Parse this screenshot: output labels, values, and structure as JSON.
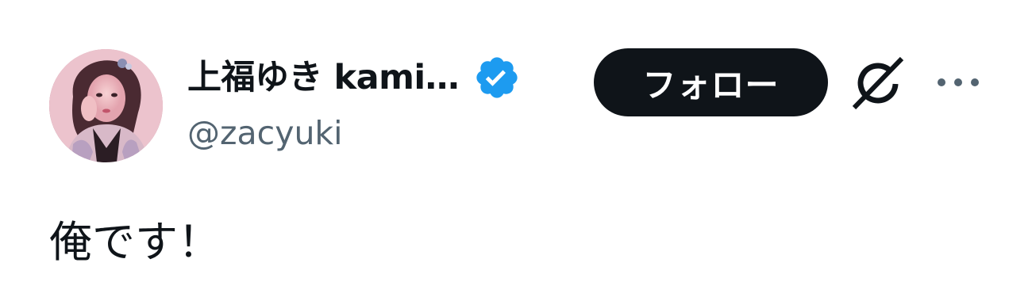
{
  "author": {
    "display_name": "上福ゆき kami…",
    "handle": "@zacyuki",
    "verified": true,
    "verified_color": "#1d9bf0",
    "avatar": "profile-photo"
  },
  "actions": {
    "follow_label": "フォロー",
    "grok_icon": "grok-icon",
    "more_icon": "more-options-icon"
  },
  "tweet": {
    "text": "俺です！"
  },
  "colors": {
    "text_primary": "#0f1419",
    "text_secondary": "#536471",
    "button_bg": "#0f1419",
    "button_text": "#ffffff"
  }
}
